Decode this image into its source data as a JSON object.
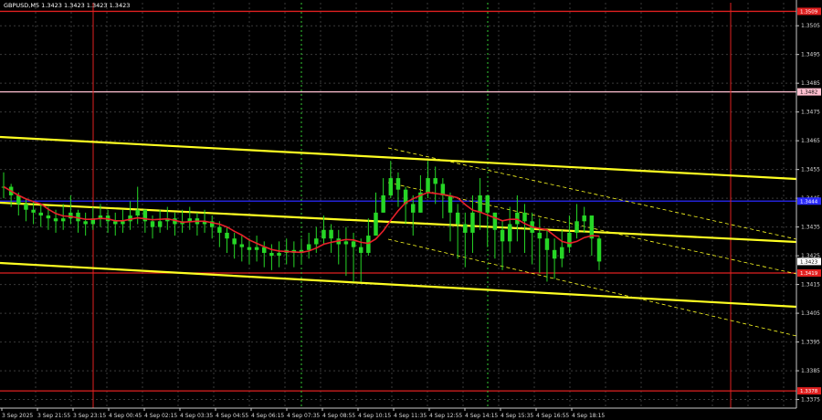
{
  "chart_data": {
    "type": "candlestick",
    "title": "GBPUSD,M5  1.3423 1.3423 1.3423 1.3423",
    "ylim": [
      1.3372,
      1.3513
    ],
    "y_ticks": [
      "1.3505",
      "1.3495",
      "1.3485",
      "1.3475",
      "1.3465",
      "1.3455",
      "1.3445",
      "1.3435",
      "1.3425",
      "1.3415",
      "1.3405",
      "1.3395",
      "1.3385",
      "1.3375"
    ],
    "x_ticks": [
      "3 Sep 2025",
      "3 Sep 21:55",
      "3 Sep 23:15",
      "4 Sep 00:45",
      "4 Sep 02:15",
      "4 Sep 03:35",
      "4 Sep 04:55",
      "4 Sep 06:15",
      "4 Sep 07:35",
      "4 Sep 08:55",
      "4 Sep 10:15",
      "4 Sep 11:35",
      "4 Sep 12:55",
      "4 Sep 14:15",
      "4 Sep 15:35",
      "4 Sep 16:55",
      "4 Sep 18:15"
    ],
    "series": {
      "close": [
        1.3449,
        1.3446,
        1.3443,
        1.3441,
        1.344,
        1.3439,
        1.3438,
        1.3437,
        1.3438,
        1.344,
        1.3437,
        1.3436,
        1.3438,
        1.3439,
        1.3437,
        1.3436,
        1.3437,
        1.3439,
        1.3441,
        1.3437,
        1.3435,
        1.3437,
        1.3438,
        1.3436,
        1.3437,
        1.3438,
        1.3436,
        1.3437,
        1.3435,
        1.3433,
        1.3431,
        1.3429,
        1.3428,
        1.3427,
        1.3428,
        1.3426,
        1.3425,
        1.3426,
        1.3427,
        1.3426,
        1.3427,
        1.3429,
        1.3431,
        1.3434,
        1.3431,
        1.3429,
        1.343,
        1.3428,
        1.3426,
        1.3432,
        1.344,
        1.3446,
        1.3452,
        1.3448,
        1.3443,
        1.344,
        1.3447,
        1.3452,
        1.345,
        1.3446,
        1.344,
        1.3436,
        1.3433,
        1.344,
        1.3446,
        1.344,
        1.3434,
        1.343,
        1.3436,
        1.344,
        1.3437,
        1.3433,
        1.3431,
        1.3427,
        1.3424,
        1.3428,
        1.3433,
        1.3437,
        1.3439,
        1.3431,
        1.3423
      ],
      "low": [
        1.3445,
        1.3442,
        1.3439,
        1.3437,
        1.3436,
        1.3435,
        1.3434,
        1.3433,
        1.3434,
        1.3436,
        1.3433,
        1.3432,
        1.3434,
        1.3435,
        1.3433,
        1.3432,
        1.3433,
        1.3434,
        1.3436,
        1.3433,
        1.3431,
        1.3433,
        1.3434,
        1.3432,
        1.3433,
        1.3434,
        1.3432,
        1.3433,
        1.3431,
        1.3428,
        1.3426,
        1.3424,
        1.3423,
        1.3422,
        1.3423,
        1.3421,
        1.342,
        1.3421,
        1.3422,
        1.3421,
        1.3422,
        1.3424,
        1.3426,
        1.3429,
        1.3426,
        1.3422,
        1.3418,
        1.3416,
        1.3416,
        1.3425,
        1.3434,
        1.344,
        1.3445,
        1.3442,
        1.3436,
        1.3432,
        1.344,
        1.3445,
        1.3443,
        1.3438,
        1.343,
        1.3424,
        1.3421,
        1.3426,
        1.3434,
        1.3428,
        1.3424,
        1.342,
        1.3426,
        1.343,
        1.3426,
        1.3422,
        1.3419,
        1.3416,
        1.3417,
        1.3421,
        1.3426,
        1.3431,
        1.3433,
        1.3425,
        1.342
      ],
      "high": [
        1.3454,
        1.345,
        1.3447,
        1.3445,
        1.3444,
        1.3443,
        1.3442,
        1.3441,
        1.3443,
        1.3446,
        1.3441,
        1.344,
        1.3442,
        1.3443,
        1.3441,
        1.344,
        1.3441,
        1.3444,
        1.3449,
        1.3441,
        1.3439,
        1.3441,
        1.3442,
        1.344,
        1.3441,
        1.3442,
        1.344,
        1.3441,
        1.3439,
        1.3437,
        1.3435,
        1.3433,
        1.3432,
        1.3431,
        1.3432,
        1.343,
        1.3429,
        1.343,
        1.3431,
        1.343,
        1.3431,
        1.3433,
        1.3435,
        1.3439,
        1.3436,
        1.3434,
        1.3435,
        1.3433,
        1.3431,
        1.3438,
        1.3447,
        1.3452,
        1.3458,
        1.3454,
        1.3449,
        1.3446,
        1.3453,
        1.3458,
        1.3456,
        1.3452,
        1.3447,
        1.3443,
        1.344,
        1.3446,
        1.3452,
        1.3446,
        1.344,
        1.3437,
        1.3442,
        1.3446,
        1.3443,
        1.344,
        1.3438,
        1.3434,
        1.3431,
        1.3434,
        1.3439,
        1.3443,
        1.3442,
        1.3437,
        1.3432
      ]
    },
    "ma_color": "#e8202a",
    "candle_color": "#26d626",
    "grid": true,
    "background": "#000000",
    "channel_color": "#ffff22",
    "horizontal_levels": [
      {
        "price": 1.351,
        "label": "1.3509",
        "color": "#e02020",
        "tag_bg": "#e02020",
        "tag_fg": "#ffffff"
      },
      {
        "price": 1.3482,
        "label": "1.3482",
        "color": "#ffc0d0",
        "tag_bg": "#ffc0d0",
        "tag_fg": "#000000"
      },
      {
        "price": 1.3444,
        "label": "1.3444",
        "color": "#2a2aff",
        "tag_bg": "#2a2aff",
        "tag_fg": "#ffffff"
      },
      {
        "price": 1.3419,
        "label": "1.3419",
        "color": "#e02020",
        "tag_bg": "#e02020",
        "tag_fg": "#ffffff"
      },
      {
        "price": 1.3378,
        "label": "1.3378",
        "color": "#e02020",
        "tag_bg": "#e02020",
        "tag_fg": "#ffffff"
      }
    ],
    "price_tags": [
      {
        "price": 1.3423,
        "label": "1.3423",
        "tag_bg": "#ffffff",
        "tag_fg": "#000000"
      }
    ]
  }
}
